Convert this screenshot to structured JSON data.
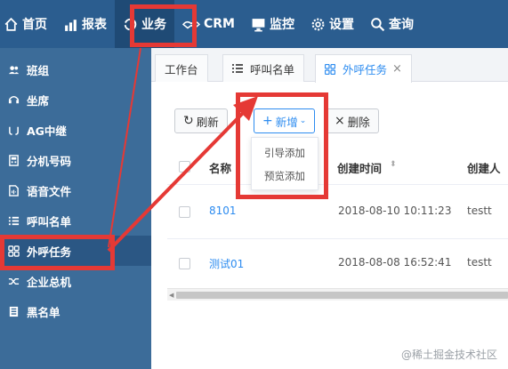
{
  "nav": {
    "items": [
      {
        "label": "首页",
        "icon": "home-icon"
      },
      {
        "label": "报表",
        "icon": "chart-icon"
      },
      {
        "label": "业务",
        "icon": "refresh-icon"
      },
      {
        "label": "CRM",
        "icon": "handshake-icon"
      },
      {
        "label": "监控",
        "icon": "monitor-icon"
      },
      {
        "label": "设置",
        "icon": "gear-icon"
      },
      {
        "label": "查询",
        "icon": "search-icon"
      }
    ],
    "active": "业务"
  },
  "sidebar": {
    "items": [
      {
        "label": "班组",
        "icon": "group-icon"
      },
      {
        "label": "坐席",
        "icon": "headset-icon"
      },
      {
        "label": "AG中继",
        "icon": "relay-icon"
      },
      {
        "label": "分机号码",
        "icon": "phone-icon"
      },
      {
        "label": "语音文件",
        "icon": "file-audio-icon"
      },
      {
        "label": "呼叫名单",
        "icon": "list-icon"
      },
      {
        "label": "外呼任务",
        "icon": "grid-icon"
      },
      {
        "label": "企业总机",
        "icon": "shuffle-icon"
      },
      {
        "label": "黑名单",
        "icon": "blacklist-icon"
      }
    ],
    "active": "外呼任务"
  },
  "tabs": [
    {
      "label": "工作台"
    },
    {
      "label": "呼叫名单"
    },
    {
      "label": "外呼任务",
      "close": "×"
    }
  ],
  "toolbar": {
    "refresh": "刷新",
    "add": "新增",
    "delete": "删除",
    "dropdown": [
      "引导添加",
      "预览添加"
    ]
  },
  "table": {
    "headers": [
      "名称",
      "创建时间",
      "创建人"
    ],
    "rows": [
      {
        "name": "8101",
        "created": "2018-08-10 10:11:23",
        "creator": "testt"
      },
      {
        "name": "测试01",
        "created": "2018-08-08 16:52:41",
        "creator": "testt"
      }
    ]
  },
  "watermark": "@稀土掘金技术社区",
  "colors": {
    "topnav": "#2b5d8f",
    "sidebar": "#3c6c99",
    "accent": "#2d8cf0",
    "highlight": "#e53935"
  }
}
